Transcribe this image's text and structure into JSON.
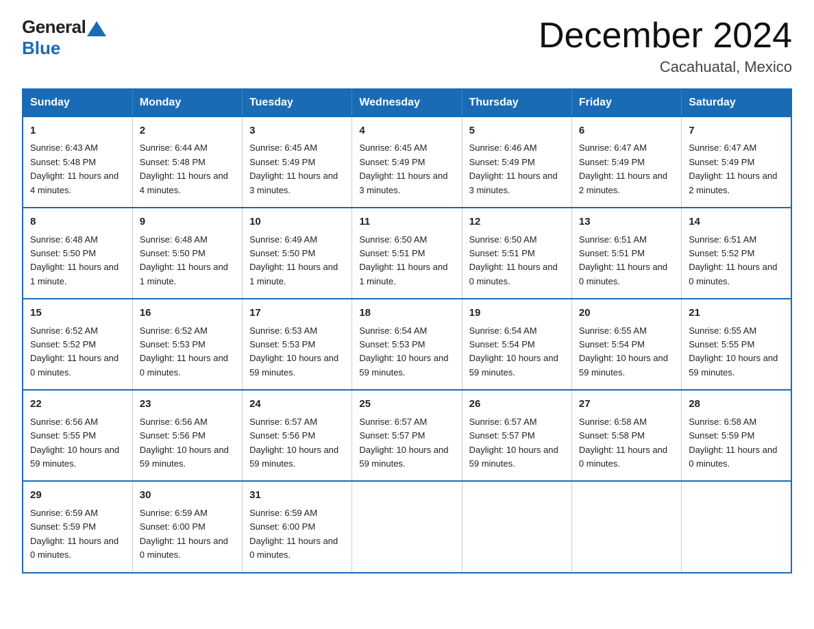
{
  "logo": {
    "text_general": "General",
    "text_blue": "Blue"
  },
  "title": "December 2024",
  "subtitle": "Cacahuatal, Mexico",
  "days_of_week": [
    "Sunday",
    "Monday",
    "Tuesday",
    "Wednesday",
    "Thursday",
    "Friday",
    "Saturday"
  ],
  "weeks": [
    [
      {
        "day": "1",
        "sunrise": "6:43 AM",
        "sunset": "5:48 PM",
        "daylight": "11 hours and 4 minutes."
      },
      {
        "day": "2",
        "sunrise": "6:44 AM",
        "sunset": "5:48 PM",
        "daylight": "11 hours and 4 minutes."
      },
      {
        "day": "3",
        "sunrise": "6:45 AM",
        "sunset": "5:49 PM",
        "daylight": "11 hours and 3 minutes."
      },
      {
        "day": "4",
        "sunrise": "6:45 AM",
        "sunset": "5:49 PM",
        "daylight": "11 hours and 3 minutes."
      },
      {
        "day": "5",
        "sunrise": "6:46 AM",
        "sunset": "5:49 PM",
        "daylight": "11 hours and 3 minutes."
      },
      {
        "day": "6",
        "sunrise": "6:47 AM",
        "sunset": "5:49 PM",
        "daylight": "11 hours and 2 minutes."
      },
      {
        "day": "7",
        "sunrise": "6:47 AM",
        "sunset": "5:49 PM",
        "daylight": "11 hours and 2 minutes."
      }
    ],
    [
      {
        "day": "8",
        "sunrise": "6:48 AM",
        "sunset": "5:50 PM",
        "daylight": "11 hours and 1 minute."
      },
      {
        "day": "9",
        "sunrise": "6:48 AM",
        "sunset": "5:50 PM",
        "daylight": "11 hours and 1 minute."
      },
      {
        "day": "10",
        "sunrise": "6:49 AM",
        "sunset": "5:50 PM",
        "daylight": "11 hours and 1 minute."
      },
      {
        "day": "11",
        "sunrise": "6:50 AM",
        "sunset": "5:51 PM",
        "daylight": "11 hours and 1 minute."
      },
      {
        "day": "12",
        "sunrise": "6:50 AM",
        "sunset": "5:51 PM",
        "daylight": "11 hours and 0 minutes."
      },
      {
        "day": "13",
        "sunrise": "6:51 AM",
        "sunset": "5:51 PM",
        "daylight": "11 hours and 0 minutes."
      },
      {
        "day": "14",
        "sunrise": "6:51 AM",
        "sunset": "5:52 PM",
        "daylight": "11 hours and 0 minutes."
      }
    ],
    [
      {
        "day": "15",
        "sunrise": "6:52 AM",
        "sunset": "5:52 PM",
        "daylight": "11 hours and 0 minutes."
      },
      {
        "day": "16",
        "sunrise": "6:52 AM",
        "sunset": "5:53 PM",
        "daylight": "11 hours and 0 minutes."
      },
      {
        "day": "17",
        "sunrise": "6:53 AM",
        "sunset": "5:53 PM",
        "daylight": "10 hours and 59 minutes."
      },
      {
        "day": "18",
        "sunrise": "6:54 AM",
        "sunset": "5:53 PM",
        "daylight": "10 hours and 59 minutes."
      },
      {
        "day": "19",
        "sunrise": "6:54 AM",
        "sunset": "5:54 PM",
        "daylight": "10 hours and 59 minutes."
      },
      {
        "day": "20",
        "sunrise": "6:55 AM",
        "sunset": "5:54 PM",
        "daylight": "10 hours and 59 minutes."
      },
      {
        "day": "21",
        "sunrise": "6:55 AM",
        "sunset": "5:55 PM",
        "daylight": "10 hours and 59 minutes."
      }
    ],
    [
      {
        "day": "22",
        "sunrise": "6:56 AM",
        "sunset": "5:55 PM",
        "daylight": "10 hours and 59 minutes."
      },
      {
        "day": "23",
        "sunrise": "6:56 AM",
        "sunset": "5:56 PM",
        "daylight": "10 hours and 59 minutes."
      },
      {
        "day": "24",
        "sunrise": "6:57 AM",
        "sunset": "5:56 PM",
        "daylight": "10 hours and 59 minutes."
      },
      {
        "day": "25",
        "sunrise": "6:57 AM",
        "sunset": "5:57 PM",
        "daylight": "10 hours and 59 minutes."
      },
      {
        "day": "26",
        "sunrise": "6:57 AM",
        "sunset": "5:57 PM",
        "daylight": "10 hours and 59 minutes."
      },
      {
        "day": "27",
        "sunrise": "6:58 AM",
        "sunset": "5:58 PM",
        "daylight": "11 hours and 0 minutes."
      },
      {
        "day": "28",
        "sunrise": "6:58 AM",
        "sunset": "5:59 PM",
        "daylight": "11 hours and 0 minutes."
      }
    ],
    [
      {
        "day": "29",
        "sunrise": "6:59 AM",
        "sunset": "5:59 PM",
        "daylight": "11 hours and 0 minutes."
      },
      {
        "day": "30",
        "sunrise": "6:59 AM",
        "sunset": "6:00 PM",
        "daylight": "11 hours and 0 minutes."
      },
      {
        "day": "31",
        "sunrise": "6:59 AM",
        "sunset": "6:00 PM",
        "daylight": "11 hours and 0 minutes."
      },
      null,
      null,
      null,
      null
    ]
  ],
  "labels": {
    "sunrise": "Sunrise:",
    "sunset": "Sunset:",
    "daylight": "Daylight:"
  }
}
